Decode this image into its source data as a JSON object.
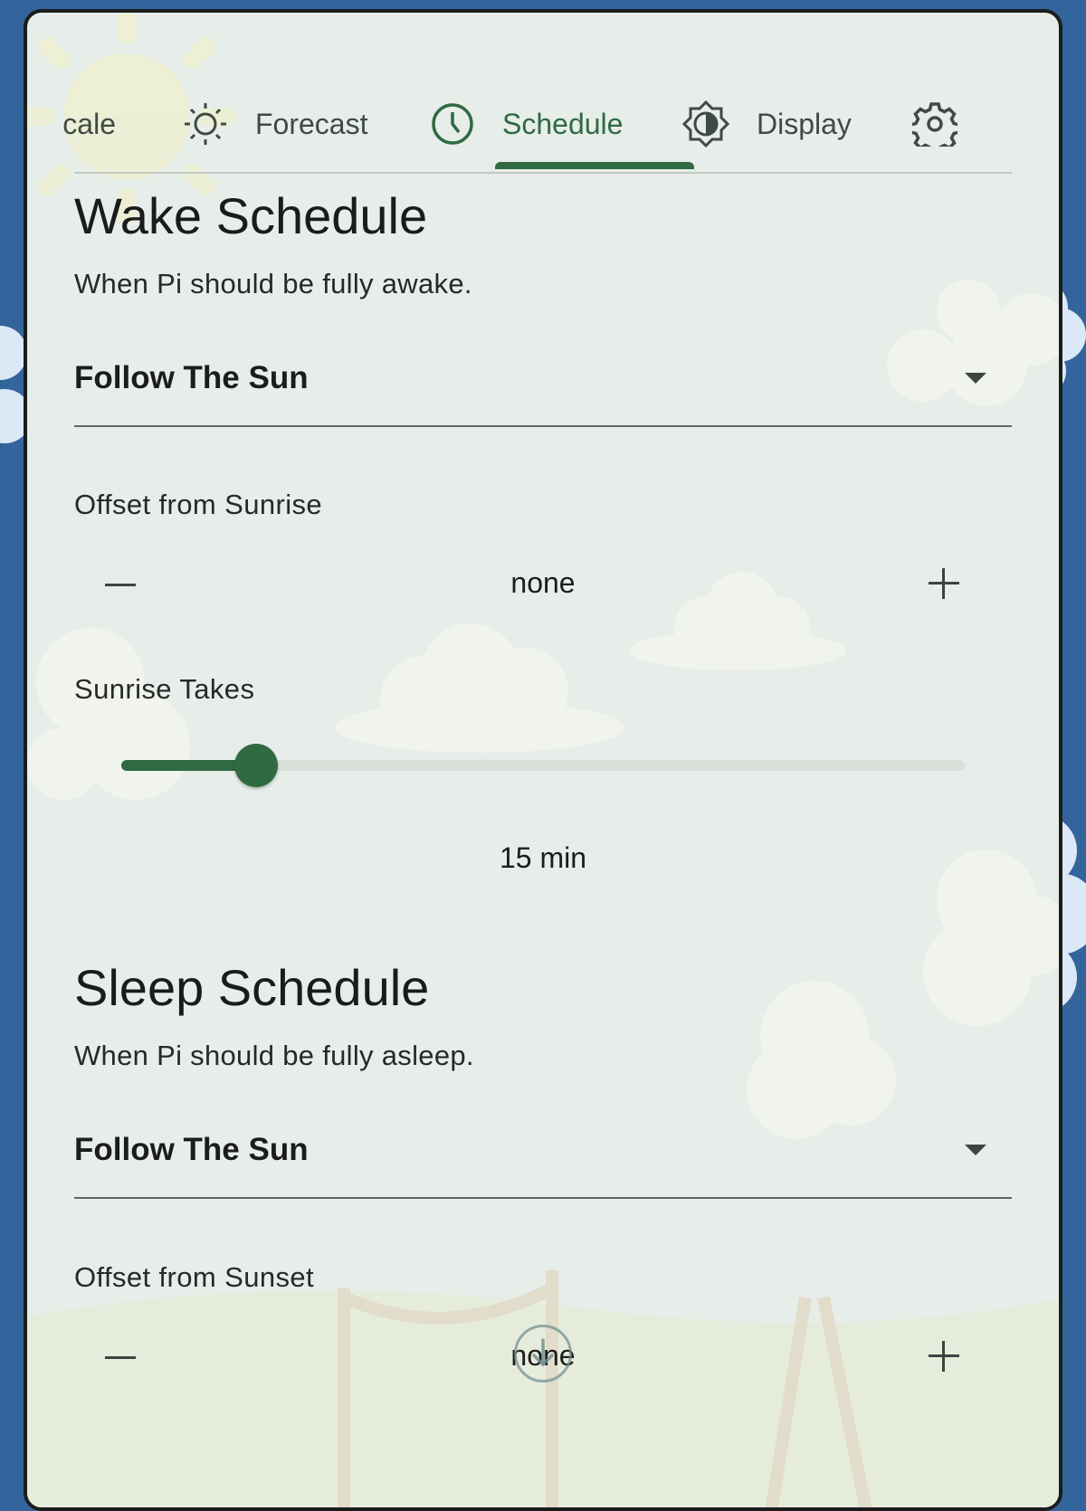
{
  "tabs": [
    {
      "label": "Scale",
      "icon": "scale-icon"
    },
    {
      "label": "Forecast",
      "icon": "sun-icon"
    },
    {
      "label": "Schedule",
      "icon": "clock-icon",
      "active": true
    },
    {
      "label": "Display",
      "icon": "brightness-icon"
    },
    {
      "label": "",
      "icon": "gear-icon"
    }
  ],
  "wake": {
    "title": "Wake Schedule",
    "description": "When Pi should be fully awake.",
    "mode": "Follow The Sun",
    "offset_label": "Offset from Sunrise",
    "offset_value": "none",
    "duration_label": "Sunrise Takes",
    "duration_value": "15 min",
    "duration_fraction": 0.16
  },
  "sleep": {
    "title": "Sleep Schedule",
    "description": "When Pi should be fully asleep.",
    "mode": "Follow The Sun",
    "offset_label": "Offset from Sunset",
    "offset_value": "none"
  },
  "colors": {
    "accent": "#2f6a41",
    "panel_bg": "#e7ede9",
    "page_bg": "#33649c"
  }
}
